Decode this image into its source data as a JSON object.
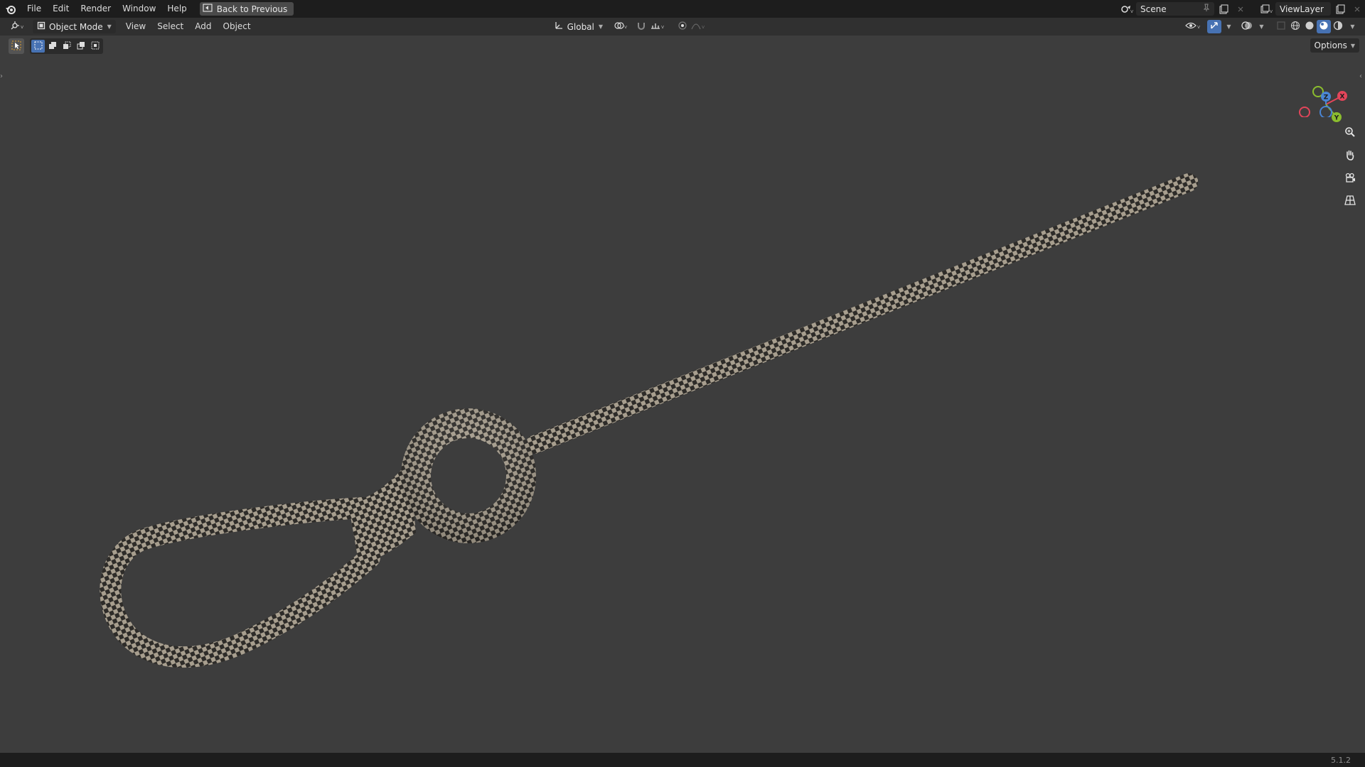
{
  "menu": {
    "items": [
      "File",
      "Edit",
      "Render",
      "Window",
      "Help"
    ],
    "back_button": "Back to Previous"
  },
  "scene": {
    "name": "Scene"
  },
  "view_layer": {
    "name": "ViewLayer"
  },
  "viewport_header": {
    "mode": "Object Mode",
    "menus": [
      "View",
      "Select",
      "Add",
      "Object"
    ],
    "transform_orientation": "Global"
  },
  "viewport": {
    "options_label": "Options",
    "gizmo_axes": {
      "x": "X",
      "y": "Y",
      "z": "Z"
    },
    "colors": {
      "background": "#3d3d3d",
      "accent": "#4772b3",
      "axis_x": "#e3455a",
      "axis_y": "#8bbd2e",
      "axis_z": "#4a85d4"
    }
  },
  "status": {
    "version": "5.1.2"
  },
  "icons": {
    "app": "blender-logo-icon",
    "editor_type": "3d-viewport-icon",
    "select_tool": "cursor-select-icon",
    "zoom": "magnify-icon",
    "pan": "hand-icon",
    "camera": "camera-view-icon",
    "ortho": "grid-perspective-icon"
  }
}
